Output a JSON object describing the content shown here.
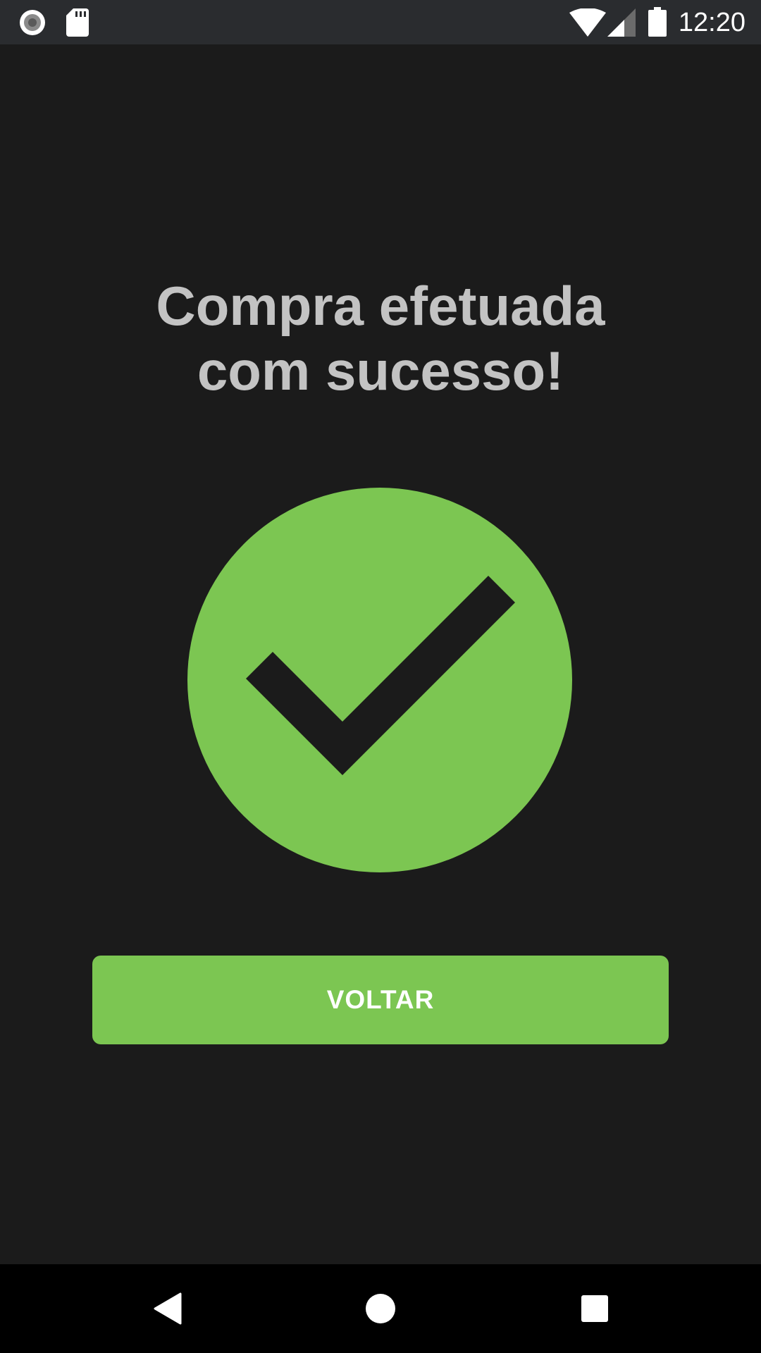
{
  "status_bar": {
    "time": "12:20",
    "icons": [
      "record-icon",
      "sd-card-icon",
      "wifi-icon",
      "cell-signal-icon",
      "battery-icon"
    ]
  },
  "main": {
    "title_line1": "Compra efetuada",
    "title_line2": "com sucesso!",
    "success_icon": "check-circle-icon",
    "button_label": "VOLTAR"
  },
  "nav_bar": {
    "icons": [
      "back-icon",
      "home-icon",
      "recents-icon"
    ]
  },
  "colors": {
    "background": "#1b1b1b",
    "status_bar": "#2a2c2f",
    "accent_green": "#7cc652",
    "title_text": "#c3c3c3",
    "nav_bar": "#000000"
  }
}
